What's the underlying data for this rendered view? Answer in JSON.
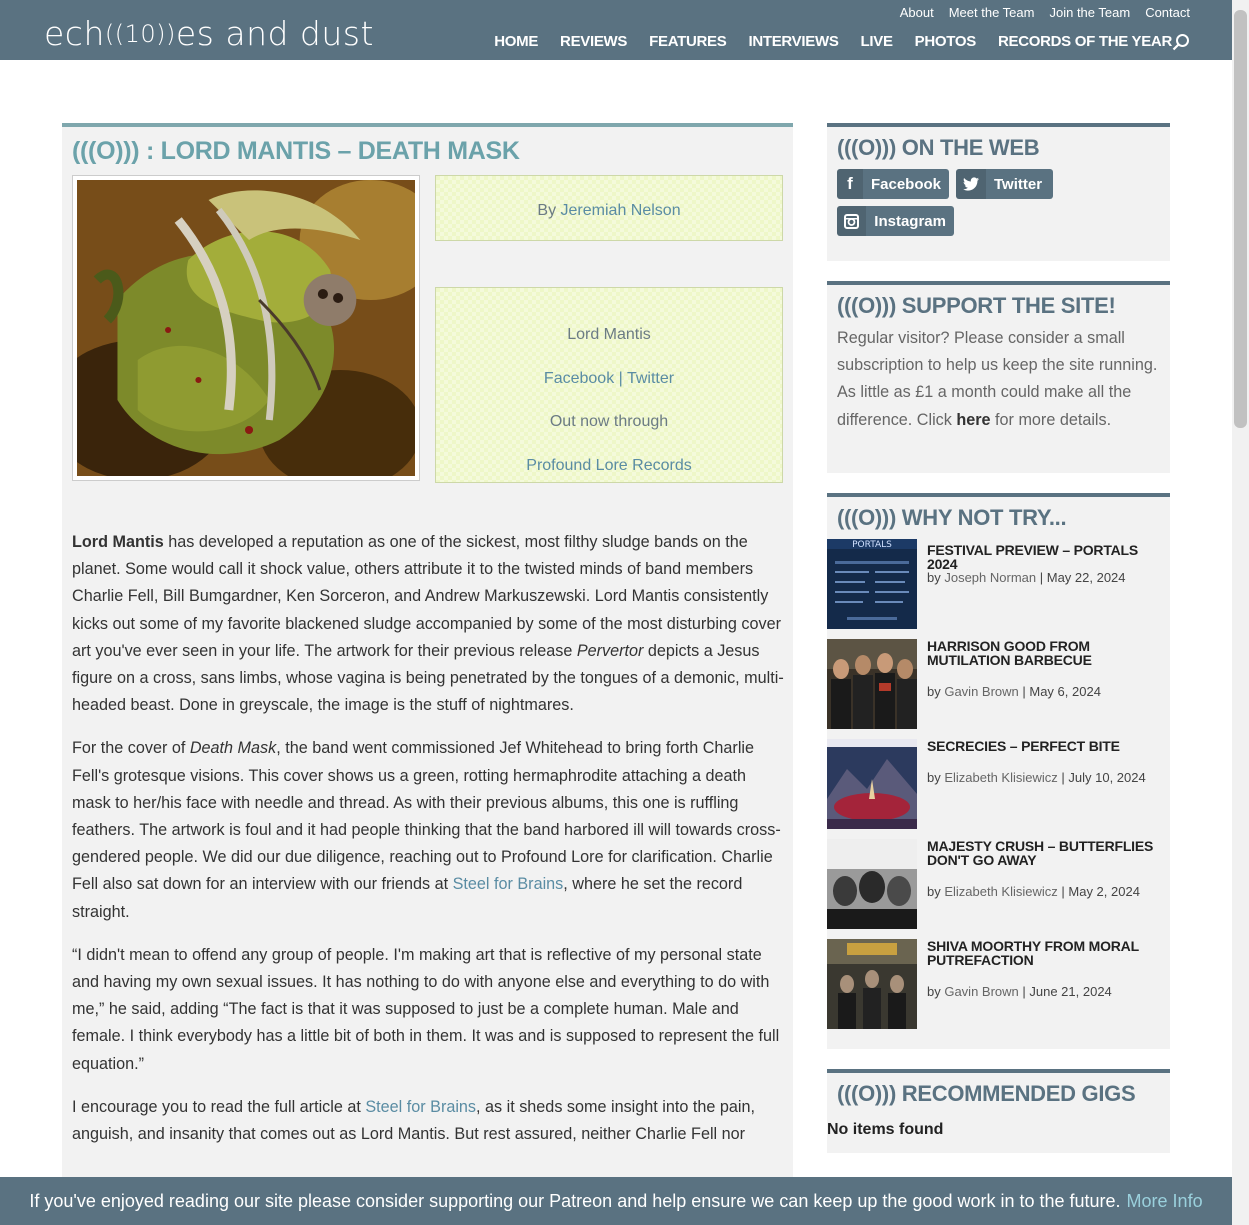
{
  "header": {
    "logo_left": "ech",
    "logo_ring": "((10))",
    "logo_right": "es and dust",
    "top_links": [
      "About",
      "Meet the Team",
      "Join the Team",
      "Contact"
    ],
    "nav": [
      "HOME",
      "REVIEWS",
      "FEATURES",
      "INTERVIEWS",
      "LIVE",
      "PHOTOS",
      "RECORDS OF THE YEAR"
    ]
  },
  "article": {
    "title": "(((O))) : LORD MANTIS – DEATH MASK",
    "by_prefix": "By ",
    "author": "Jeremiah Nelson",
    "band": "Lord Mantis",
    "facebook": "Facebook",
    "separator": " | ",
    "twitter": "Twitter",
    "out_now": "Out now through",
    "label": "Profound Lore Records",
    "p1_bold": "Lord Mantis",
    "p1_a": " has developed a reputation as one of the sickest, most filthy sludge bands on the planet. Some would call it shock value, others attribute it to the twisted minds of band members Charlie Fell, Bill Bumgardner, Ken Sorceron, and Andrew Markuszewski. Lord Mantis consistently kicks out some of my favorite blackened sludge accompanied by some of the most disturbing cover art you've ever seen in your life. The artwork for their previous release ",
    "p1_italic": "Pervertor",
    "p1_b": " depicts a Jesus figure on a cross, sans limbs, whose vagina is being penetrated by the tongues of a demonic, multi-headed beast. Done in greyscale, the image is the stuff of nightmares.",
    "p2_a": "For the cover of ",
    "p2_italic": "Death Mask",
    "p2_b": ", the band went commissioned Jef Whitehead to bring forth Charlie Fell's grotesque visions. This cover shows us a green, rotting hermaphrodite attaching a death mask to her/his face with needle and thread. As with their previous albums, this one is ruffling feathers. The artwork is foul and it had people thinking that the band harbored ill will towards cross-gendered people. We did our due diligence, reaching out to Profound Lore for clarification. Charlie Fell also sat down for an interview with our friends at ",
    "p2_link": "Steel for Brains",
    "p2_c": ", where he set the record straight.",
    "p3": "“I didn't mean to offend any group of people. I'm making art that is reflective of my personal state and having my own sexual issues. It has nothing to do with anyone else and everything to do with me,” he said, adding “The fact is that it was supposed to just be a complete human. Male and female. I think everybody has a little bit of both in them. It was and is supposed to represent the full equation.”",
    "p4_a": "I encourage you to read the full article at ",
    "p4_link": "Steel for Brains",
    "p4_b": ", as it sheds some insight into the pain, anguish, and insanity that comes out as Lord Mantis. But rest assured, neither Charlie Fell nor"
  },
  "sidebar": {
    "web_title": "(((O))) ON THE WEB",
    "facebook": "Facebook",
    "twitter": "Twitter",
    "instagram": "Instagram",
    "support_title": "(((O))) SUPPORT THE SITE!",
    "support_a": "Regular visitor? Please consider a small subscription to help us keep the site running. As little as £1 a month could make all the difference. Click ",
    "support_link": "here",
    "support_b": " for more details.",
    "why_title": "(((O))) WHY NOT TRY...",
    "why_items": [
      {
        "title": "FESTIVAL PREVIEW – PORTALS 2024",
        "author": "Joseph Norman",
        "date": "May 22, 2024"
      },
      {
        "title": "HARRISON GOOD FROM MUTILATION BARBECUE",
        "author": "Gavin Brown",
        "date": "May 6, 2024"
      },
      {
        "title": "SECRECIES – PERFECT BITE",
        "author": "Elizabeth Klisiewicz",
        "date": "July 10, 2024"
      },
      {
        "title": "MAJESTY CRUSH – BUTTERFLIES DON'T GO AWAY",
        "author": "Elizabeth Klisiewicz",
        "date": "May 2, 2024"
      },
      {
        "title": "SHIVA MOORTHY FROM MORAL PUTREFACTION",
        "author": "Gavin Brown",
        "date": "June 21, 2024"
      }
    ],
    "by": "by ",
    "pipe": " | ",
    "gigs_title": "(((O))) RECOMMENDED GIGS",
    "gigs_empty": "No items found"
  },
  "banner": {
    "text": "If you've enjoyed reading our site please consider supporting our Patreon and help ensure we can keep up the good work in to the future.",
    "more": "More Info"
  },
  "colors": {
    "header": "#5a7281",
    "title_teal": "#6ba2aa",
    "link": "#5a8ca3",
    "infobox": "#eef7c8"
  }
}
